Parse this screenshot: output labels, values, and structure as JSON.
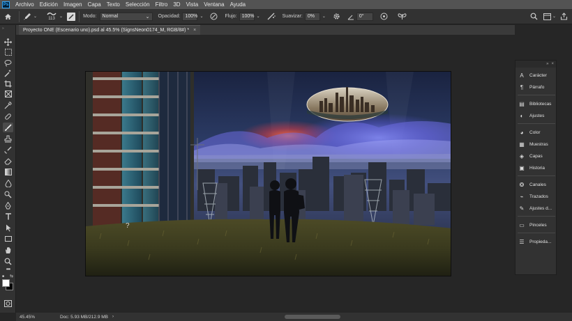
{
  "menu": {
    "logo": "Ps",
    "items": [
      "Archivo",
      "Edición",
      "Imagen",
      "Capa",
      "Texto",
      "Selección",
      "Filtro",
      "3D",
      "Vista",
      "Ventana",
      "Ayuda"
    ]
  },
  "options": {
    "brush_size": "113",
    "mode_label": "Modo:",
    "mode_value": "Normal",
    "opacity_label": "Opacidad:",
    "opacity_value": "100%",
    "flow_label": "Flujo:",
    "flow_value": "100%",
    "smooth_label": "Suavizar:",
    "smooth_value": "0%",
    "angle_value": "0°"
  },
  "document": {
    "tab_title": "Proyecto ONE (Escenario uno).psd al 45.5% (SignsNeon0174_M, RGB/8#) *",
    "close": "×"
  },
  "panels": {
    "items": [
      "Carácter",
      "Párrafo",
      "Bibliotecas",
      "Ajustes",
      "Color",
      "Muestras",
      "Capas",
      "Historia",
      "Canales",
      "Trazados",
      "Ajustes d...",
      "Pinceles",
      "Propieda..."
    ]
  },
  "status": {
    "zoom": "45.45%",
    "doc_info": "Doc: 5.93 MB/212.9 MB"
  },
  "colors": {
    "accent": "#31a8ff",
    "panel_bg": "#323232",
    "canvas_bg": "#262626"
  }
}
